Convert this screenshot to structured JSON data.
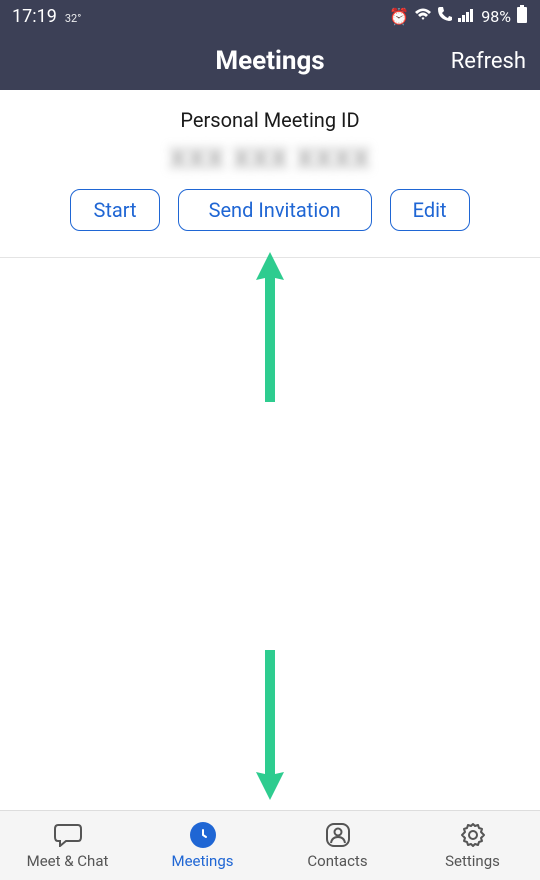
{
  "status": {
    "time": "17:19",
    "temp": "32°",
    "battery_pct": "98%"
  },
  "header": {
    "title": "Meetings",
    "refresh_label": "Refresh"
  },
  "pmi": {
    "label": "Personal Meeting ID",
    "value": "XXX XXX XXXX"
  },
  "buttons": {
    "start": "Start",
    "send_invitation": "Send Invitation",
    "edit": "Edit"
  },
  "tabs": {
    "meet_chat": "Meet & Chat",
    "meetings": "Meetings",
    "contacts": "Contacts",
    "settings": "Settings"
  },
  "colors": {
    "accent": "#1f66d4",
    "header_bg": "#3c4056",
    "arrow": "#2ecc8f"
  }
}
